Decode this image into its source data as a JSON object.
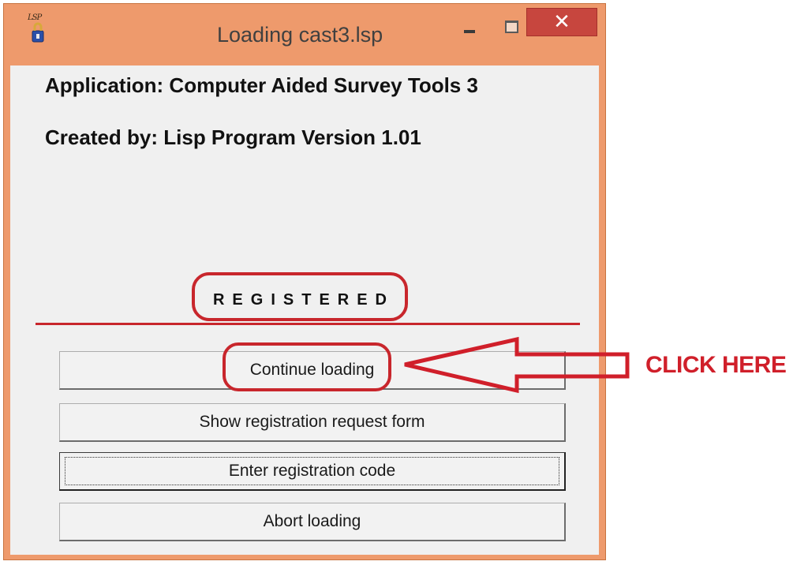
{
  "window": {
    "title": "Loading cast3.lsp",
    "app_icon_text": "LSP",
    "close_glyph": "✕",
    "colors": {
      "frame": "#ee9a6c",
      "close": "#c7463e",
      "client": "#f0f0f0",
      "annotation": "#c8262c"
    }
  },
  "info": {
    "application": "Application: Computer Aided Survey Tools 3",
    "created_by": "Created by: Lisp Program Version 1.01"
  },
  "status": {
    "registered": "REGISTERED"
  },
  "buttons": {
    "continue": "Continue loading",
    "show_form": "Show registration request form",
    "enter_code": "Enter registration code",
    "abort": "Abort loading"
  },
  "annotation": {
    "callout": "CLICK HERE"
  }
}
